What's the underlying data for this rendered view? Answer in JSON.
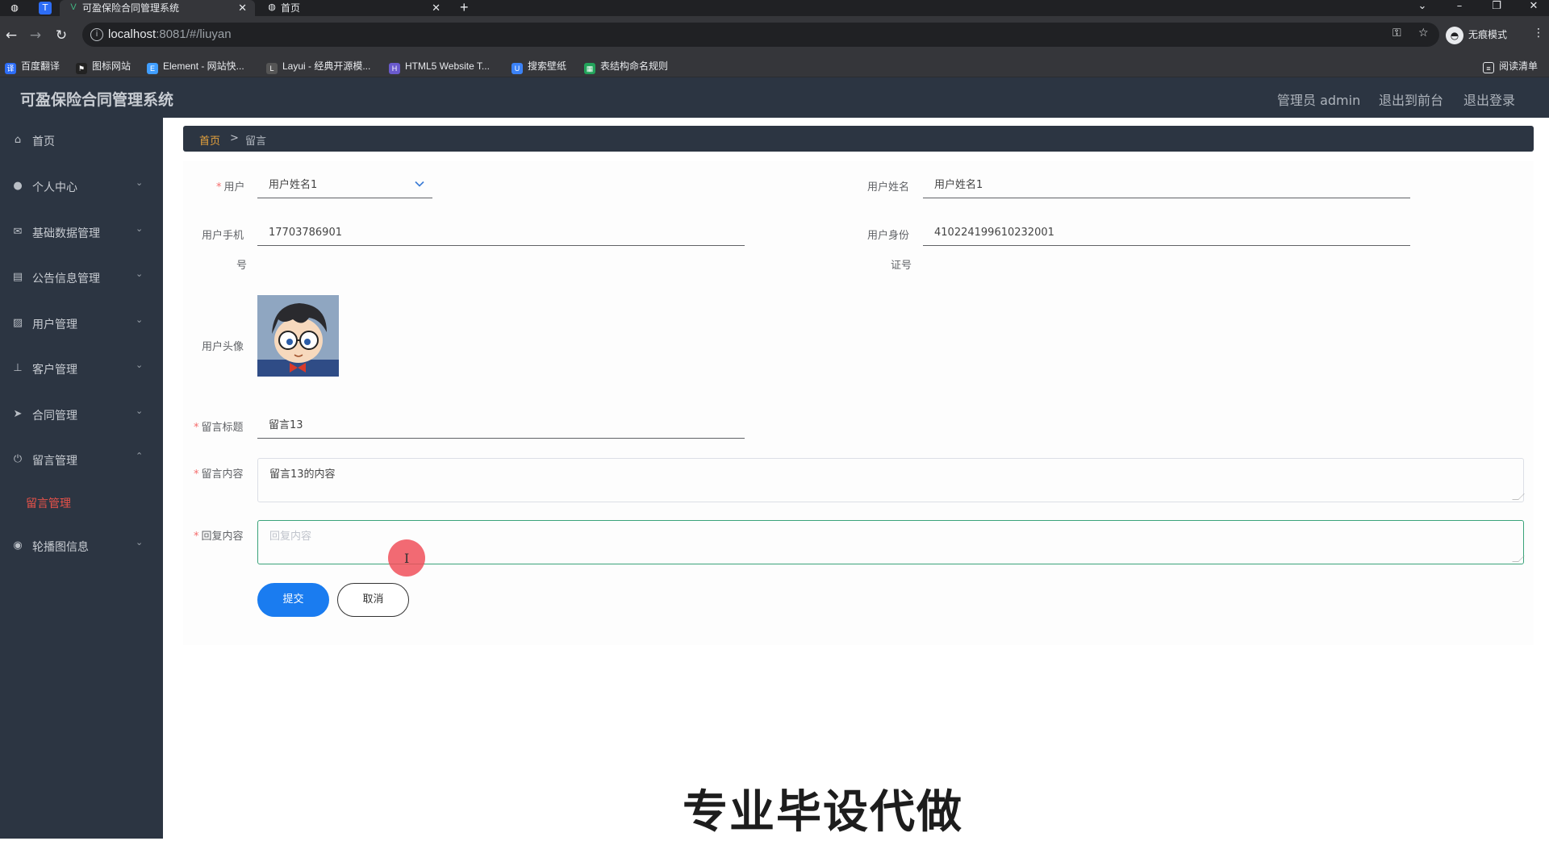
{
  "browser": {
    "tabs": [
      {
        "title": "可盈保险合同管理系统",
        "active": true
      },
      {
        "title": "首页",
        "active": false
      }
    ],
    "new_tab": "+",
    "url_host": "localhost",
    "url_path": ":8081/#/liuyan",
    "incognito_label": "无痕模式",
    "bookmarks": [
      {
        "label": "百度翻译",
        "color": "#2d6df6"
      },
      {
        "label": "图标网站",
        "color": "#222222"
      },
      {
        "label": "Element - 网站快...",
        "color": "#409eff"
      },
      {
        "label": "Layui - 经典开源模...",
        "color": "#555555"
      },
      {
        "label": "HTML5 Website T...",
        "color": "#6a5acd"
      },
      {
        "label": "搜索壁纸",
        "color": "#3b82f6"
      },
      {
        "label": "表结构命名规则",
        "color": "#22a35a"
      }
    ],
    "reading_list": "阅读清单"
  },
  "app": {
    "title": "可盈保险合同管理系统",
    "admin": "管理员 admin",
    "to_front": "退出到前台",
    "logout": "退出登录"
  },
  "sidebar": {
    "items": [
      {
        "label": "首页",
        "icon": "home-icon",
        "glyph": "⌂",
        "arrow": ""
      },
      {
        "label": "个人中心",
        "icon": "user-icon",
        "glyph": "●",
        "arrow": "⌄"
      },
      {
        "label": "基础数据管理",
        "icon": "message-icon",
        "glyph": "✉",
        "arrow": "⌄"
      },
      {
        "label": "公告信息管理",
        "icon": "clipboard-icon",
        "glyph": "▤",
        "arrow": "⌄"
      },
      {
        "label": "用户管理",
        "icon": "chart-icon",
        "glyph": "▨",
        "arrow": "⌄"
      },
      {
        "label": "客户管理",
        "icon": "stamp-icon",
        "glyph": "⊥",
        "arrow": "⌄"
      },
      {
        "label": "合同管理",
        "icon": "send-icon",
        "glyph": "➤",
        "arrow": "⌄"
      },
      {
        "label": "留言管理",
        "icon": "power-icon",
        "glyph": "⏻",
        "arrow": "⌃"
      },
      {
        "label": "轮播图信息",
        "icon": "location-icon",
        "glyph": "◉",
        "arrow": "⌄"
      }
    ],
    "active_sub": "留言管理"
  },
  "breadcrumb": {
    "home": "首页",
    "sep": ">",
    "current": "留言"
  },
  "form": {
    "user_label": "用户",
    "user_value": "用户姓名1",
    "username_label": "用户姓名",
    "username_value": "用户姓名1",
    "phone_label_1": "用户手机",
    "phone_label_2": "号",
    "phone_value": "17703786901",
    "idcard_label_1": "用户身份",
    "idcard_label_2": "证号",
    "idcard_value": "410224199610232001",
    "avatar_label": "用户头像",
    "title_label": "留言标题",
    "title_value": "留言13",
    "content_label": "留言内容",
    "content_value": "留言13的内容",
    "reply_label": "回复内容",
    "reply_placeholder": "回复内容",
    "submit": "提交",
    "cancel": "取消"
  },
  "watermark": "专业毕设代做"
}
